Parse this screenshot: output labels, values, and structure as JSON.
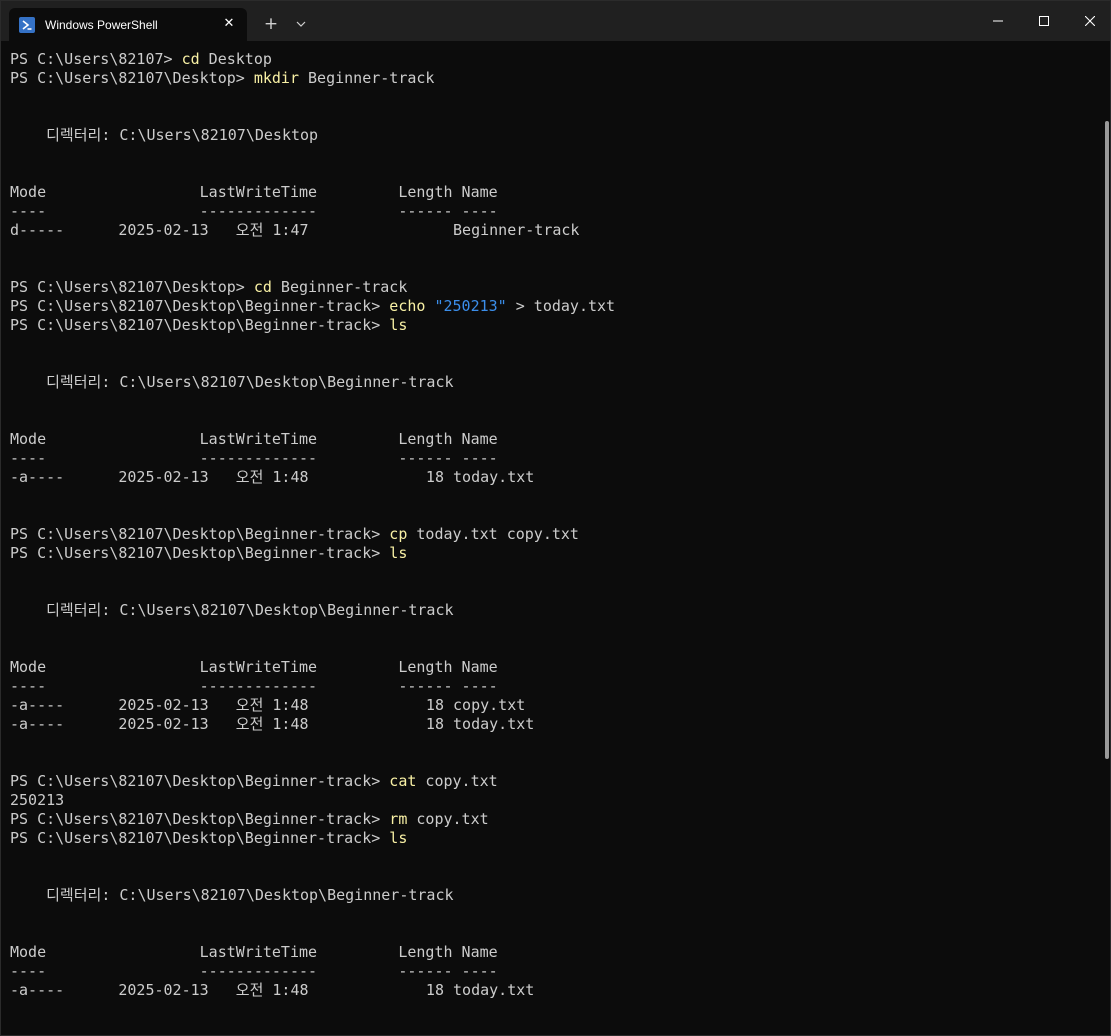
{
  "app": {
    "tab_title": "Windows PowerShell",
    "tab_icon": "powershell-icon",
    "new_tab_label": "+",
    "tab_close_label": "✕"
  },
  "colors": {
    "background": "#0c0c0c",
    "titlebar": "#202020",
    "text": "#cccccc",
    "command": "#f9f1a5",
    "string": "#3b8eea"
  },
  "terminal": {
    "lines": [
      [
        {
          "t": "PS C:\\Users\\82107> "
        },
        {
          "t": "cd",
          "c": "cmd"
        },
        {
          "t": " Desktop"
        }
      ],
      [
        {
          "t": "PS C:\\Users\\82107\\Desktop> "
        },
        {
          "t": "mkdir",
          "c": "cmd"
        },
        {
          "t": " Beginner-track"
        }
      ],
      [],
      [],
      [
        {
          "t": "    디렉터리: C:\\Users\\82107\\Desktop"
        }
      ],
      [],
      [],
      [
        {
          "t": "Mode                 LastWriteTime         Length Name"
        }
      ],
      [
        {
          "t": "----                 -------------         ------ ----"
        }
      ],
      [
        {
          "t": "d-----      2025-02-13   오전 1:47                Beginner-track"
        }
      ],
      [],
      [],
      [
        {
          "t": "PS C:\\Users\\82107\\Desktop> "
        },
        {
          "t": "cd",
          "c": "cmd"
        },
        {
          "t": " Beginner-track"
        }
      ],
      [
        {
          "t": "PS C:\\Users\\82107\\Desktop\\Beginner-track> "
        },
        {
          "t": "echo",
          "c": "cmd"
        },
        {
          "t": " "
        },
        {
          "t": "\"250213\"",
          "c": "str"
        },
        {
          "t": " > today.txt"
        }
      ],
      [
        {
          "t": "PS C:\\Users\\82107\\Desktop\\Beginner-track> "
        },
        {
          "t": "ls",
          "c": "cmd"
        }
      ],
      [],
      [],
      [
        {
          "t": "    디렉터리: C:\\Users\\82107\\Desktop\\Beginner-track"
        }
      ],
      [],
      [],
      [
        {
          "t": "Mode                 LastWriteTime         Length Name"
        }
      ],
      [
        {
          "t": "----                 -------------         ------ ----"
        }
      ],
      [
        {
          "t": "-a----      2025-02-13   오전 1:48             18 today.txt"
        }
      ],
      [],
      [],
      [
        {
          "t": "PS C:\\Users\\82107\\Desktop\\Beginner-track> "
        },
        {
          "t": "cp",
          "c": "cmd"
        },
        {
          "t": " today.txt copy.txt"
        }
      ],
      [
        {
          "t": "PS C:\\Users\\82107\\Desktop\\Beginner-track> "
        },
        {
          "t": "ls",
          "c": "cmd"
        }
      ],
      [],
      [],
      [
        {
          "t": "    디렉터리: C:\\Users\\82107\\Desktop\\Beginner-track"
        }
      ],
      [],
      [],
      [
        {
          "t": "Mode                 LastWriteTime         Length Name"
        }
      ],
      [
        {
          "t": "----                 -------------         ------ ----"
        }
      ],
      [
        {
          "t": "-a----      2025-02-13   오전 1:48             18 copy.txt"
        }
      ],
      [
        {
          "t": "-a----      2025-02-13   오전 1:48             18 today.txt"
        }
      ],
      [],
      [],
      [
        {
          "t": "PS C:\\Users\\82107\\Desktop\\Beginner-track> "
        },
        {
          "t": "cat",
          "c": "cmd"
        },
        {
          "t": " copy.txt"
        }
      ],
      [
        {
          "t": "250213"
        }
      ],
      [
        {
          "t": "PS C:\\Users\\82107\\Desktop\\Beginner-track> "
        },
        {
          "t": "rm",
          "c": "cmd"
        },
        {
          "t": " copy.txt"
        }
      ],
      [
        {
          "t": "PS C:\\Users\\82107\\Desktop\\Beginner-track> "
        },
        {
          "t": "ls",
          "c": "cmd"
        }
      ],
      [],
      [],
      [
        {
          "t": "    디렉터리: C:\\Users\\82107\\Desktop\\Beginner-track"
        }
      ],
      [],
      [],
      [
        {
          "t": "Mode                 LastWriteTime         Length Name"
        }
      ],
      [
        {
          "t": "----                 -------------         ------ ----"
        }
      ],
      [
        {
          "t": "-a----      2025-02-13   오전 1:48             18 today.txt"
        }
      ]
    ]
  }
}
